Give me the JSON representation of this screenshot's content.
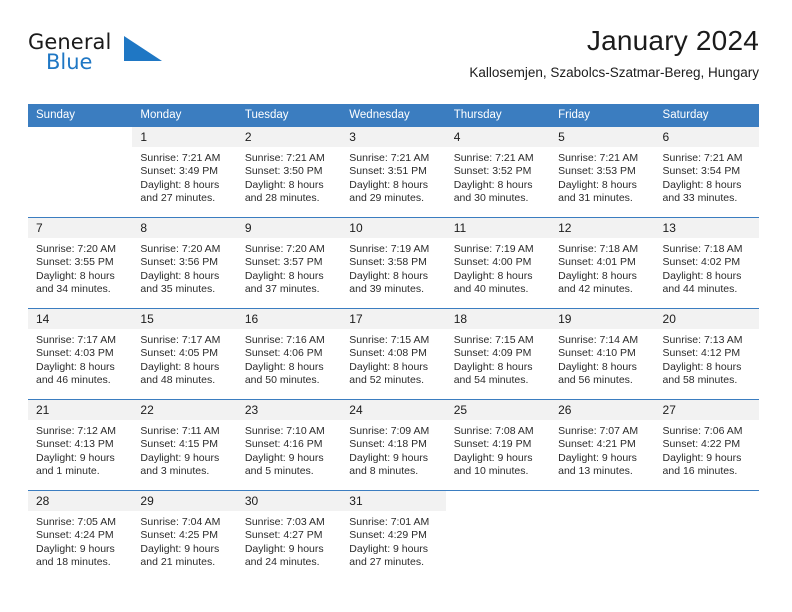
{
  "brand": {
    "name_top": "General",
    "name_bottom": "Blue",
    "top_color": "#1a1a1a",
    "bottom_color": "#1f77c4",
    "triangle_color": "#1f77c4",
    "triangle_icon": "triangle-icon"
  },
  "header": {
    "title": "January 2024",
    "subtitle": "Kallosemjen, Szabolcs-Szatmar-Bereg, Hungary"
  },
  "theme": {
    "header_bg": "#3b7dc0",
    "header_text": "#ffffff",
    "daynum_bg": "#f2f2f2",
    "rule_color": "#3b7dc0",
    "body_text": "#2b2b2b"
  },
  "labels": {
    "sunrise_prefix": "Sunrise:",
    "sunset_prefix": "Sunset:",
    "daylight_prefix": "Daylight:"
  },
  "weekdays": [
    "Sunday",
    "Monday",
    "Tuesday",
    "Wednesday",
    "Thursday",
    "Friday",
    "Saturday"
  ],
  "weeks": [
    [
      {
        "day": "",
        "empty": true,
        "sunrise": "",
        "sunset": "",
        "daylight_line1": "",
        "daylight_line2": ""
      },
      {
        "day": "1",
        "sunrise": "Sunrise: 7:21 AM",
        "sunset": "Sunset: 3:49 PM",
        "daylight_line1": "Daylight: 8 hours",
        "daylight_line2": "and 27 minutes."
      },
      {
        "day": "2",
        "sunrise": "Sunrise: 7:21 AM",
        "sunset": "Sunset: 3:50 PM",
        "daylight_line1": "Daylight: 8 hours",
        "daylight_line2": "and 28 minutes."
      },
      {
        "day": "3",
        "sunrise": "Sunrise: 7:21 AM",
        "sunset": "Sunset: 3:51 PM",
        "daylight_line1": "Daylight: 8 hours",
        "daylight_line2": "and 29 minutes."
      },
      {
        "day": "4",
        "sunrise": "Sunrise: 7:21 AM",
        "sunset": "Sunset: 3:52 PM",
        "daylight_line1": "Daylight: 8 hours",
        "daylight_line2": "and 30 minutes."
      },
      {
        "day": "5",
        "sunrise": "Sunrise: 7:21 AM",
        "sunset": "Sunset: 3:53 PM",
        "daylight_line1": "Daylight: 8 hours",
        "daylight_line2": "and 31 minutes."
      },
      {
        "day": "6",
        "sunrise": "Sunrise: 7:21 AM",
        "sunset": "Sunset: 3:54 PM",
        "daylight_line1": "Daylight: 8 hours",
        "daylight_line2": "and 33 minutes."
      }
    ],
    [
      {
        "day": "7",
        "sunrise": "Sunrise: 7:20 AM",
        "sunset": "Sunset: 3:55 PM",
        "daylight_line1": "Daylight: 8 hours",
        "daylight_line2": "and 34 minutes."
      },
      {
        "day": "8",
        "sunrise": "Sunrise: 7:20 AM",
        "sunset": "Sunset: 3:56 PM",
        "daylight_line1": "Daylight: 8 hours",
        "daylight_line2": "and 35 minutes."
      },
      {
        "day": "9",
        "sunrise": "Sunrise: 7:20 AM",
        "sunset": "Sunset: 3:57 PM",
        "daylight_line1": "Daylight: 8 hours",
        "daylight_line2": "and 37 minutes."
      },
      {
        "day": "10",
        "sunrise": "Sunrise: 7:19 AM",
        "sunset": "Sunset: 3:58 PM",
        "daylight_line1": "Daylight: 8 hours",
        "daylight_line2": "and 39 minutes."
      },
      {
        "day": "11",
        "sunrise": "Sunrise: 7:19 AM",
        "sunset": "Sunset: 4:00 PM",
        "daylight_line1": "Daylight: 8 hours",
        "daylight_line2": "and 40 minutes."
      },
      {
        "day": "12",
        "sunrise": "Sunrise: 7:18 AM",
        "sunset": "Sunset: 4:01 PM",
        "daylight_line1": "Daylight: 8 hours",
        "daylight_line2": "and 42 minutes."
      },
      {
        "day": "13",
        "sunrise": "Sunrise: 7:18 AM",
        "sunset": "Sunset: 4:02 PM",
        "daylight_line1": "Daylight: 8 hours",
        "daylight_line2": "and 44 minutes."
      }
    ],
    [
      {
        "day": "14",
        "sunrise": "Sunrise: 7:17 AM",
        "sunset": "Sunset: 4:03 PM",
        "daylight_line1": "Daylight: 8 hours",
        "daylight_line2": "and 46 minutes."
      },
      {
        "day": "15",
        "sunrise": "Sunrise: 7:17 AM",
        "sunset": "Sunset: 4:05 PM",
        "daylight_line1": "Daylight: 8 hours",
        "daylight_line2": "and 48 minutes."
      },
      {
        "day": "16",
        "sunrise": "Sunrise: 7:16 AM",
        "sunset": "Sunset: 4:06 PM",
        "daylight_line1": "Daylight: 8 hours",
        "daylight_line2": "and 50 minutes."
      },
      {
        "day": "17",
        "sunrise": "Sunrise: 7:15 AM",
        "sunset": "Sunset: 4:08 PM",
        "daylight_line1": "Daylight: 8 hours",
        "daylight_line2": "and 52 minutes."
      },
      {
        "day": "18",
        "sunrise": "Sunrise: 7:15 AM",
        "sunset": "Sunset: 4:09 PM",
        "daylight_line1": "Daylight: 8 hours",
        "daylight_line2": "and 54 minutes."
      },
      {
        "day": "19",
        "sunrise": "Sunrise: 7:14 AM",
        "sunset": "Sunset: 4:10 PM",
        "daylight_line1": "Daylight: 8 hours",
        "daylight_line2": "and 56 minutes."
      },
      {
        "day": "20",
        "sunrise": "Sunrise: 7:13 AM",
        "sunset": "Sunset: 4:12 PM",
        "daylight_line1": "Daylight: 8 hours",
        "daylight_line2": "and 58 minutes."
      }
    ],
    [
      {
        "day": "21",
        "sunrise": "Sunrise: 7:12 AM",
        "sunset": "Sunset: 4:13 PM",
        "daylight_line1": "Daylight: 9 hours",
        "daylight_line2": "and 1 minute."
      },
      {
        "day": "22",
        "sunrise": "Sunrise: 7:11 AM",
        "sunset": "Sunset: 4:15 PM",
        "daylight_line1": "Daylight: 9 hours",
        "daylight_line2": "and 3 minutes."
      },
      {
        "day": "23",
        "sunrise": "Sunrise: 7:10 AM",
        "sunset": "Sunset: 4:16 PM",
        "daylight_line1": "Daylight: 9 hours",
        "daylight_line2": "and 5 minutes."
      },
      {
        "day": "24",
        "sunrise": "Sunrise: 7:09 AM",
        "sunset": "Sunset: 4:18 PM",
        "daylight_line1": "Daylight: 9 hours",
        "daylight_line2": "and 8 minutes."
      },
      {
        "day": "25",
        "sunrise": "Sunrise: 7:08 AM",
        "sunset": "Sunset: 4:19 PM",
        "daylight_line1": "Daylight: 9 hours",
        "daylight_line2": "and 10 minutes."
      },
      {
        "day": "26",
        "sunrise": "Sunrise: 7:07 AM",
        "sunset": "Sunset: 4:21 PM",
        "daylight_line1": "Daylight: 9 hours",
        "daylight_line2": "and 13 minutes."
      },
      {
        "day": "27",
        "sunrise": "Sunrise: 7:06 AM",
        "sunset": "Sunset: 4:22 PM",
        "daylight_line1": "Daylight: 9 hours",
        "daylight_line2": "and 16 minutes."
      }
    ],
    [
      {
        "day": "28",
        "sunrise": "Sunrise: 7:05 AM",
        "sunset": "Sunset: 4:24 PM",
        "daylight_line1": "Daylight: 9 hours",
        "daylight_line2": "and 18 minutes."
      },
      {
        "day": "29",
        "sunrise": "Sunrise: 7:04 AM",
        "sunset": "Sunset: 4:25 PM",
        "daylight_line1": "Daylight: 9 hours",
        "daylight_line2": "and 21 minutes."
      },
      {
        "day": "30",
        "sunrise": "Sunrise: 7:03 AM",
        "sunset": "Sunset: 4:27 PM",
        "daylight_line1": "Daylight: 9 hours",
        "daylight_line2": "and 24 minutes."
      },
      {
        "day": "31",
        "sunrise": "Sunrise: 7:01 AM",
        "sunset": "Sunset: 4:29 PM",
        "daylight_line1": "Daylight: 9 hours",
        "daylight_line2": "and 27 minutes."
      },
      {
        "day": "",
        "empty": true,
        "sunrise": "",
        "sunset": "",
        "daylight_line1": "",
        "daylight_line2": ""
      },
      {
        "day": "",
        "empty": true,
        "sunrise": "",
        "sunset": "",
        "daylight_line1": "",
        "daylight_line2": ""
      },
      {
        "day": "",
        "empty": true,
        "sunrise": "",
        "sunset": "",
        "daylight_line1": "",
        "daylight_line2": ""
      }
    ]
  ]
}
